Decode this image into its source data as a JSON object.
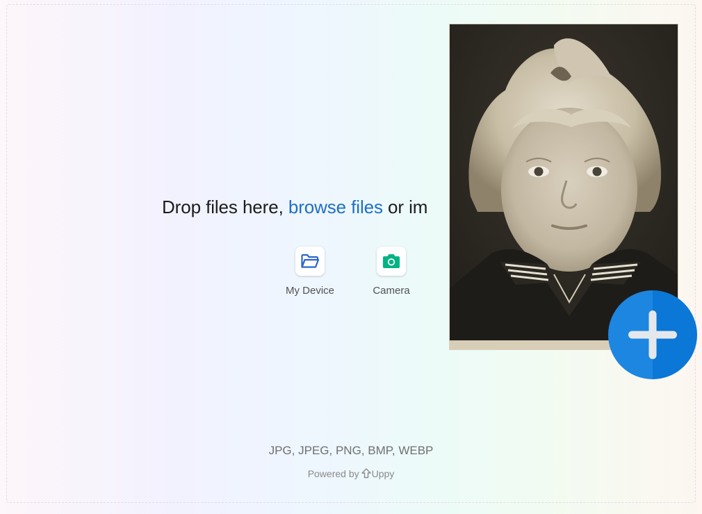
{
  "dashboard": {
    "title_prefix": "Drop files here, ",
    "browse_label": "browse files",
    "title_suffix": " or im",
    "sources": [
      {
        "label": "My Device",
        "icon": "folder-open-icon"
      },
      {
        "label": "Camera",
        "icon": "camera-icon"
      }
    ],
    "note": "JPG, JPEG, PNG, BMP, WEBP",
    "powered_by": "Powered by",
    "brand": "Uppy"
  },
  "overlay": {
    "photo": "vintage-portrait-photo",
    "add_button_icon": "plus-icon"
  },
  "colors": {
    "browse_link": "#1f6fc4",
    "device_icon": "#2a65c9",
    "camera_icon": "#02b383",
    "fab": "#1d86e0"
  }
}
